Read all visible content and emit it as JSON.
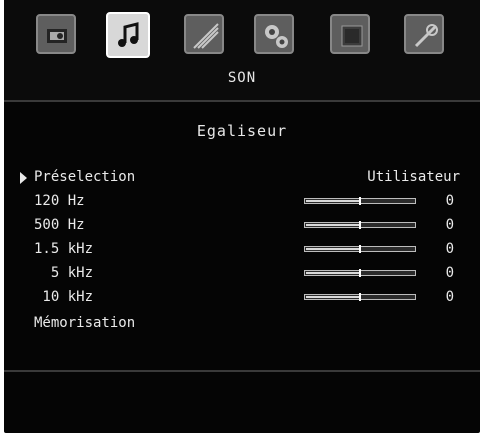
{
  "header": {
    "section": "SON",
    "tabs": [
      {
        "icon": "picture-icon"
      },
      {
        "icon": "sound-icon",
        "active": true
      },
      {
        "icon": "feature-icon"
      },
      {
        "icon": "settings-icon"
      },
      {
        "icon": "source-icon"
      },
      {
        "icon": "installation-icon"
      }
    ]
  },
  "panel": {
    "title": "Egaliseur",
    "preselection": {
      "label": "Préselection",
      "value": "Utilisateur"
    },
    "bands": [
      {
        "label": "120 Hz",
        "value": "0",
        "level": 0.5
      },
      {
        "label": "500 Hz",
        "value": "0",
        "level": 0.5
      },
      {
        "label": "1.5 kHz",
        "value": "0",
        "level": 0.5
      },
      {
        "label": "  5 kHz",
        "value": "0",
        "level": 0.5
      },
      {
        "label": " 10 kHz",
        "value": "0",
        "level": 0.5
      }
    ],
    "store_label": "Mémorisation"
  },
  "colors": {
    "background": "#050505",
    "text": "#eaeaea",
    "tab_active": "#d8d8d8",
    "tab_inactive": "#5e5e5e"
  }
}
